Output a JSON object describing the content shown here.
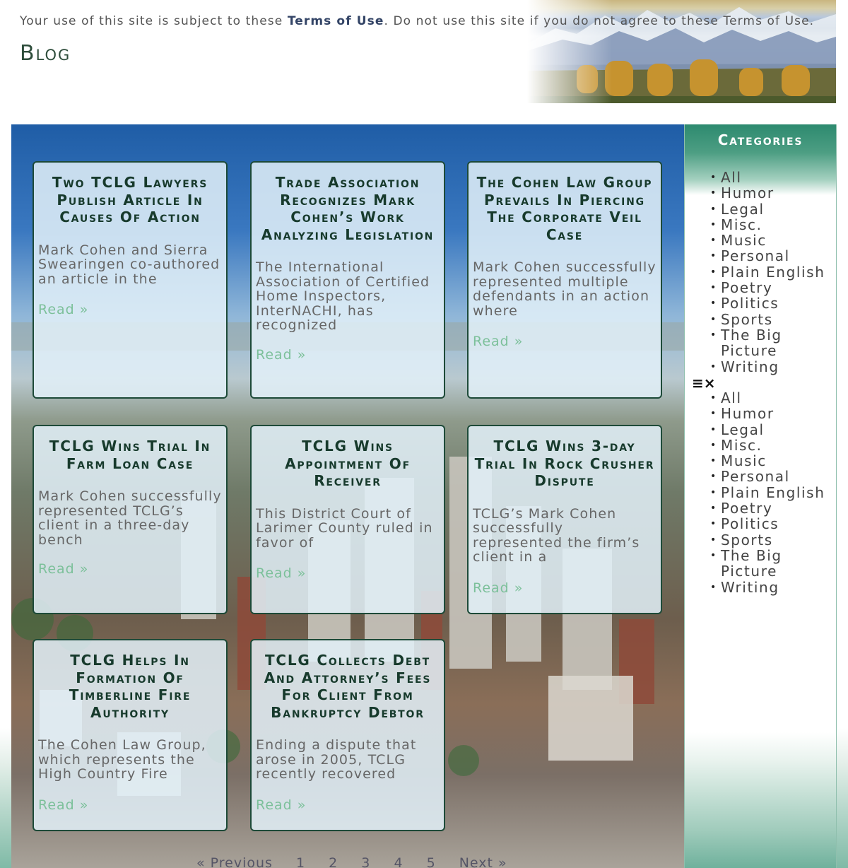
{
  "header": {
    "terms_prefix": "Your use of this site is subject to these ",
    "terms_link": "Terms of Use",
    "terms_suffix": ". Do not use this site if you do not agree to these Terms of Use.",
    "page_title": "Blog"
  },
  "posts": [
    {
      "title": "Two TCLG Lawyers Publish Article In Causes Of Action",
      "excerpt": "Mark Cohen and Sierra Swearingen co-authored an article in the",
      "read": "Read »"
    },
    {
      "title": "Trade Association Recognizes Mark Cohen’s Work Analyzing Legislation",
      "excerpt": "The International Association of Certified Home Inspectors, InterNACHI, has recognized",
      "read": "Read »"
    },
    {
      "title": "The Cohen Law Group Prevails In Piercing The Corporate Veil Case",
      "excerpt": "Mark Cohen successfully represented multiple defendants in an action where",
      "read": "Read »"
    },
    {
      "title": "TCLG Wins Trial In Farm Loan Case",
      "excerpt": "Mark Cohen successfully represented TCLG’s client in a three-day bench",
      "read": "Read »"
    },
    {
      "title": "TCLG Wins Appointment Of Receiver",
      "excerpt": "This District Court of Larimer County ruled in favor of",
      "read": "Read »"
    },
    {
      "title": "TCLG Wins 3-day Trial In Rock Crusher Dispute",
      "excerpt": "TCLG’s Mark Cohen successfully represented the firm’s client in a",
      "read": "Read »"
    },
    {
      "title": "TCLG Helps In Formation Of Timberline Fire Authority",
      "excerpt": "The Cohen Law Group, which represents the High Country Fire",
      "read": "Read »"
    },
    {
      "title": "TCLG Collects Debt And Attorney’s Fees For Client From Bankruptcy Debtor",
      "excerpt": "Ending a dispute that arose in 2005, TCLG recently recovered",
      "read": "Read »"
    }
  ],
  "pagination": {
    "previous": "« Previous",
    "pages": [
      "1",
      "2",
      "3",
      "4",
      "5"
    ],
    "next": "Next »"
  },
  "sidebar": {
    "title": "Categories",
    "categories": [
      "All",
      "Humor",
      "Legal",
      "Misc.",
      "Music",
      "Personal",
      "Plain English",
      "Poetry",
      "Politics",
      "Sports",
      "The Big Picture",
      "Writing"
    ],
    "menu_toggle_icon": "≡×"
  }
}
